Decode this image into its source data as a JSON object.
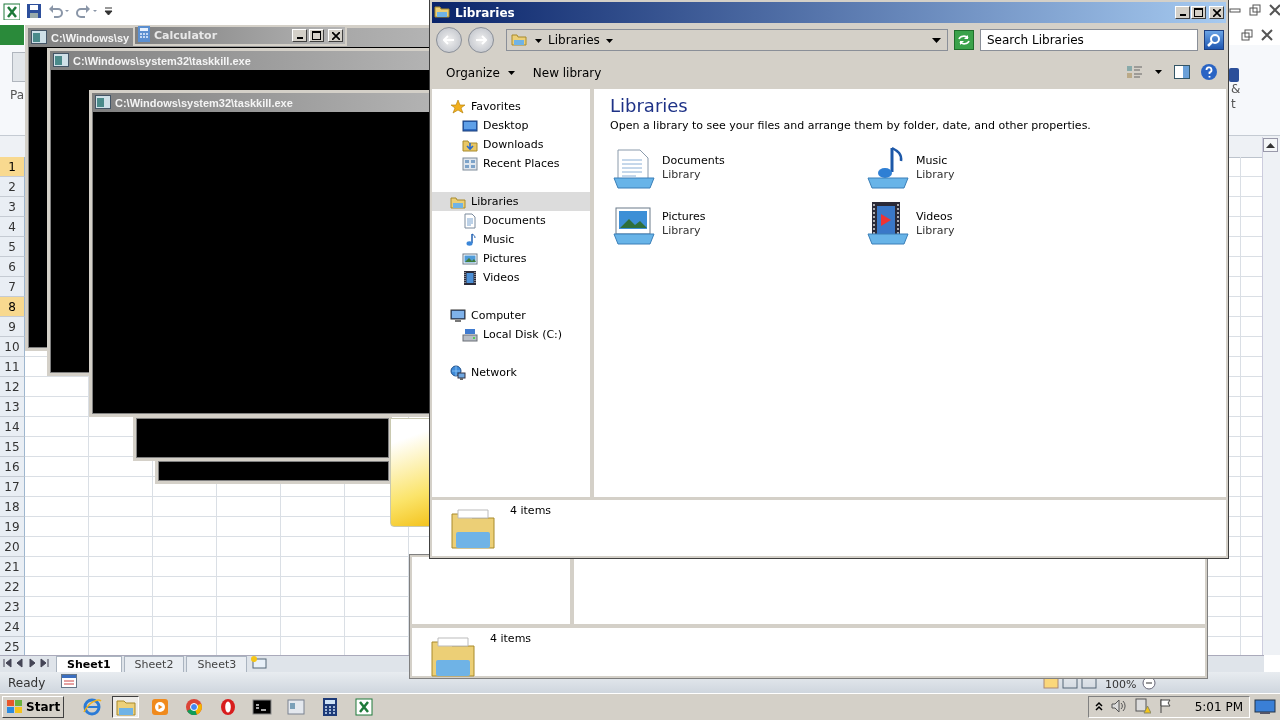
{
  "excel": {
    "ribbon_left_text": "Pa",
    "ribbon_right_texts": [
      "&",
      "t"
    ],
    "row_headers": [
      {
        "label": "1",
        "selected": true
      },
      {
        "label": "2",
        "selected": false
      },
      {
        "label": "3",
        "selected": false
      },
      {
        "label": "4",
        "selected": false
      },
      {
        "label": "5",
        "selected": false
      },
      {
        "label": "6",
        "selected": false
      },
      {
        "label": "7",
        "selected": false
      },
      {
        "label": "8",
        "selected": true
      },
      {
        "label": "9",
        "selected": false
      },
      {
        "label": "10",
        "selected": false
      },
      {
        "label": "11",
        "selected": false
      },
      {
        "label": "12",
        "selected": false
      },
      {
        "label": "13",
        "selected": false
      },
      {
        "label": "14",
        "selected": false
      },
      {
        "label": "15",
        "selected": false
      },
      {
        "label": "16",
        "selected": false
      },
      {
        "label": "17",
        "selected": false
      },
      {
        "label": "18",
        "selected": false
      },
      {
        "label": "19",
        "selected": false
      },
      {
        "label": "20",
        "selected": false
      },
      {
        "label": "21",
        "selected": false
      },
      {
        "label": "22",
        "selected": false
      },
      {
        "label": "23",
        "selected": false
      },
      {
        "label": "24",
        "selected": false
      },
      {
        "label": "25",
        "selected": false
      }
    ],
    "sheet_tabs": [
      {
        "label": "Sheet1",
        "selected": true
      },
      {
        "label": "Sheet2",
        "selected": false
      },
      {
        "label": "Sheet3",
        "selected": false
      }
    ],
    "status": "Ready",
    "zoom": "100%"
  },
  "consoles": [
    {
      "title": "C:\\Windows\\sy"
    },
    {
      "title": "C:\\Windows\\system32\\taskkill.exe"
    },
    {
      "title": "C:\\Windows\\system32\\taskkill.exe"
    }
  ],
  "calculator": {
    "title": "Calculator"
  },
  "background_explorer": {
    "status": "4 items"
  },
  "explorer": {
    "title": "Libraries",
    "breadcrumb": "Libraries",
    "search": {
      "placeholder": "Search Libraries"
    },
    "toolbar": [
      {
        "label": "Organize",
        "kind": "menu"
      },
      {
        "label": "New library",
        "kind": "plain"
      }
    ],
    "nav": [
      {
        "label": "Favorites",
        "kind": "favorites",
        "selected": false,
        "children": [
          {
            "label": "Desktop",
            "kind": "desktop",
            "selected": false
          },
          {
            "label": "Downloads",
            "kind": "downloads",
            "selected": false
          },
          {
            "label": "Recent Places",
            "kind": "recent",
            "selected": false
          }
        ]
      },
      {
        "label": "Libraries",
        "kind": "libraries",
        "selected": true,
        "children": [
          {
            "label": "Documents",
            "kind": "documents",
            "selected": false
          },
          {
            "label": "Music",
            "kind": "music",
            "selected": false
          },
          {
            "label": "Pictures",
            "kind": "pictures",
            "selected": false
          },
          {
            "label": "Videos",
            "kind": "videos",
            "selected": false
          }
        ]
      },
      {
        "label": "Computer",
        "kind": "computer",
        "selected": false,
        "children": [
          {
            "label": "Local Disk (C:)",
            "kind": "disk",
            "selected": false
          }
        ]
      },
      {
        "label": "Network",
        "kind": "network",
        "selected": false
      }
    ],
    "heading": "Libraries",
    "description": "Open a library to see your files and arrange them by folder, date, and other properties.",
    "libraries": [
      {
        "name": "Documents",
        "type": "Library",
        "kind": "documents"
      },
      {
        "name": "Music",
        "type": "Library",
        "kind": "music"
      },
      {
        "name": "Pictures",
        "type": "Library",
        "kind": "pictures"
      },
      {
        "name": "Videos",
        "type": "Library",
        "kind": "videos"
      }
    ],
    "status": "4 items"
  },
  "taskbar": {
    "start": "Start",
    "apps": [
      {
        "kind": "ie",
        "selected": false
      },
      {
        "kind": "explorer",
        "selected": true
      },
      {
        "kind": "media",
        "selected": false
      },
      {
        "kind": "chrome",
        "selected": false
      },
      {
        "kind": "opera",
        "selected": false
      },
      {
        "kind": "cmd",
        "selected": false
      },
      {
        "kind": "window",
        "selected": false
      },
      {
        "kind": "calculator",
        "selected": false
      },
      {
        "kind": "excel",
        "selected": false
      }
    ],
    "clock": "5:01 PM"
  }
}
